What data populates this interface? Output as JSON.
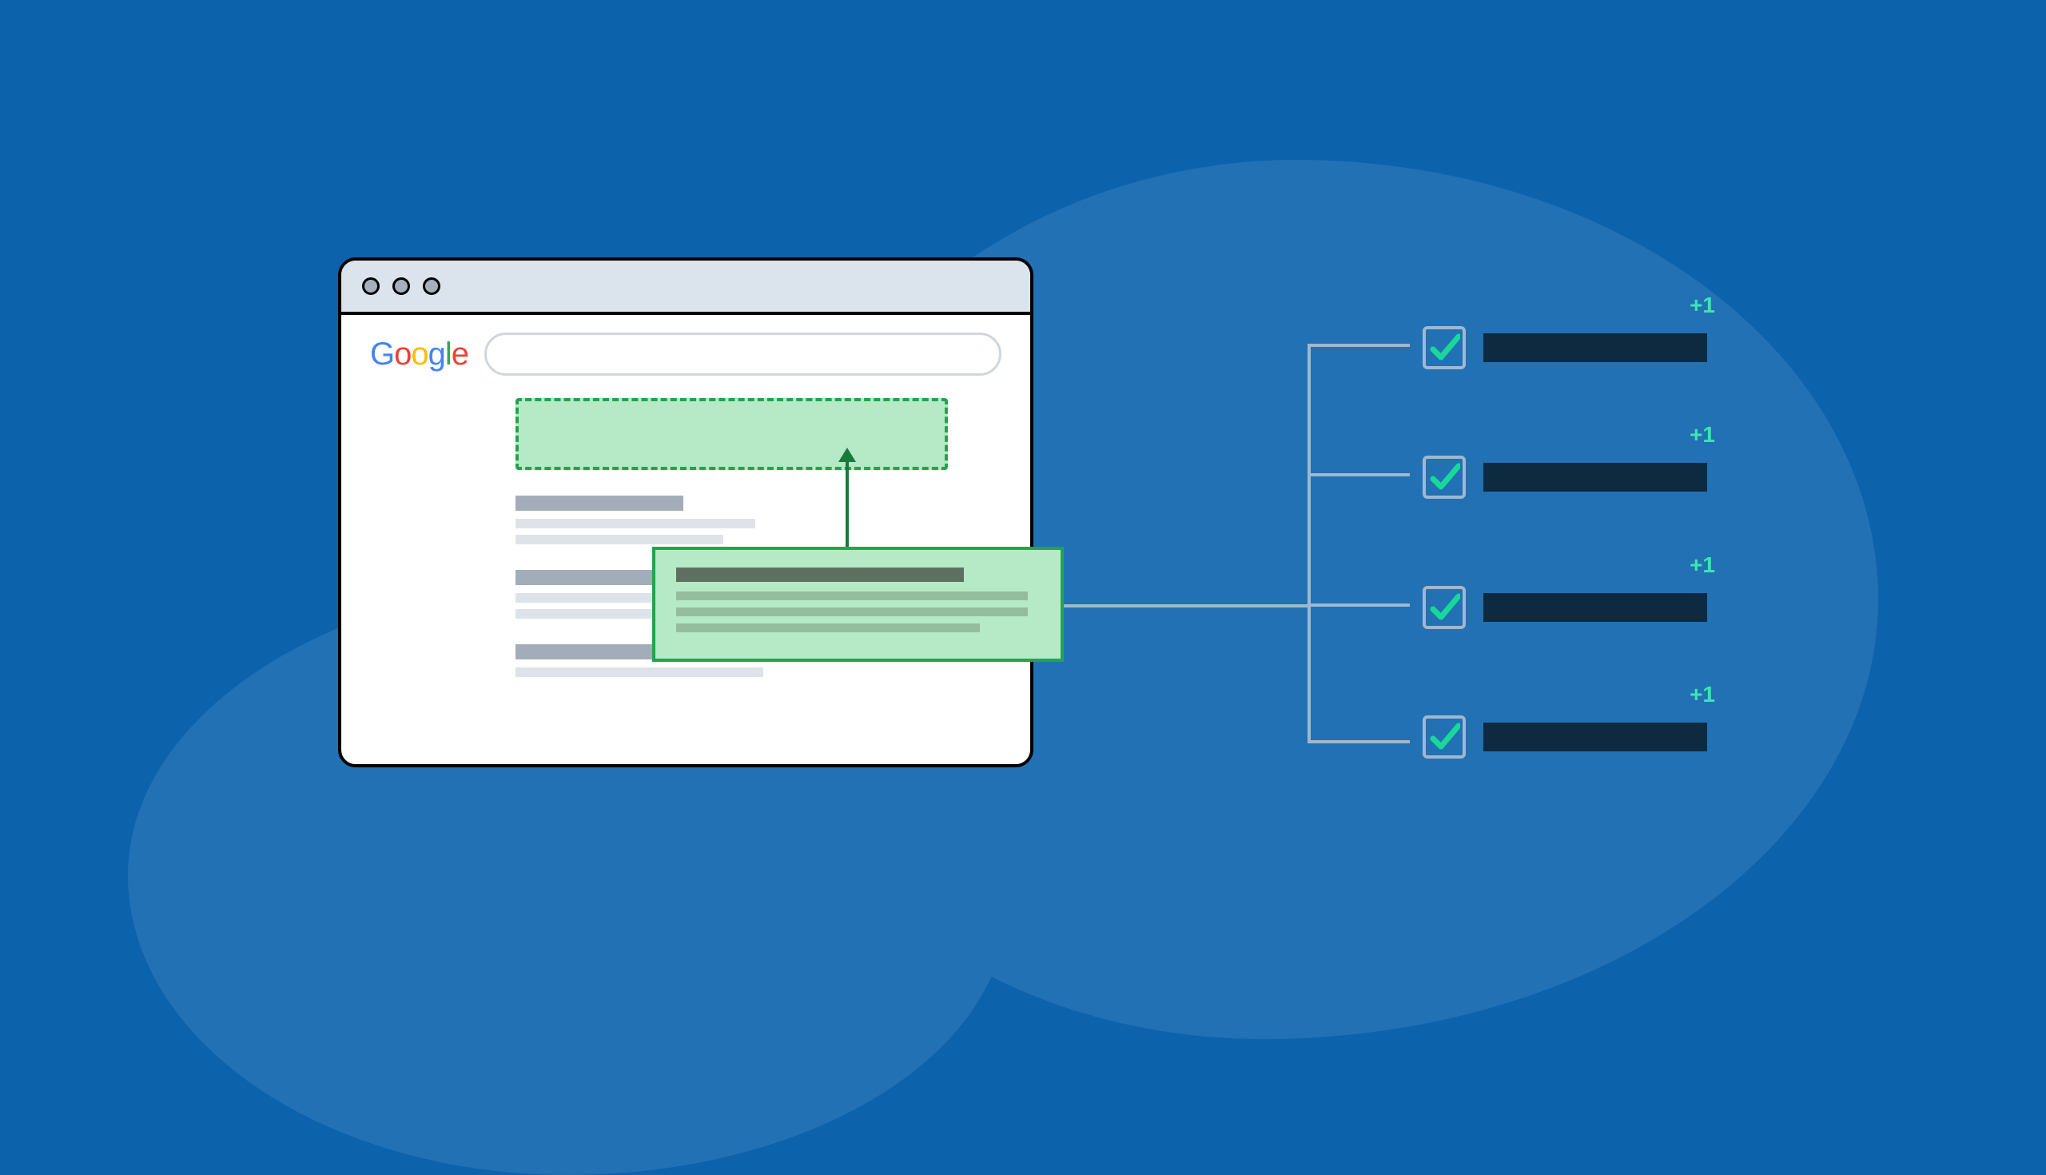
{
  "brand": {
    "name": "Google",
    "letters": [
      "G",
      "o",
      "o",
      "g",
      "l",
      "e"
    ]
  },
  "checklist": {
    "count": 4,
    "badge": "+1",
    "positions_top": [
      408,
      570,
      733,
      895
    ]
  },
  "connectors": {
    "bracket_arms_top": [
      430,
      592,
      755,
      926
    ]
  },
  "colors": {
    "bg": "#0d62ac",
    "blob": "#2271b5",
    "accent_green": "#22a44d",
    "fill_green": "#b6e9c6",
    "check_teal": "#3de4b3",
    "dark_bar": "#0e2a40"
  }
}
